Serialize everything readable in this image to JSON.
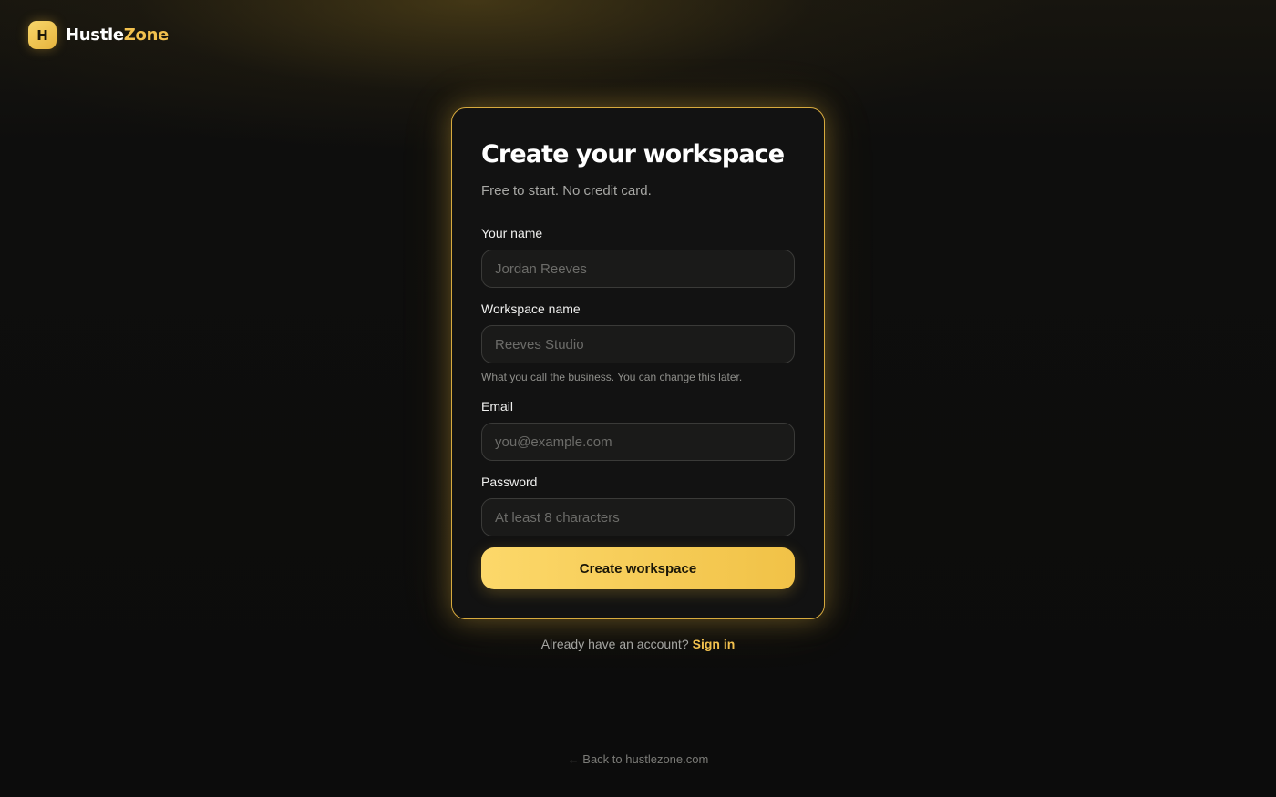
{
  "brand": {
    "mark_letter": "H",
    "name_part1": "Hustle",
    "name_part2": "Zone"
  },
  "form": {
    "title": "Create your workspace",
    "subtitle": "Free to start. No credit card.",
    "fields": [
      {
        "label": "Your name",
        "placeholder": "Jordan Reeves",
        "value": ""
      },
      {
        "label": "Workspace name",
        "placeholder": "Reeves Studio",
        "value": "",
        "help": "What you call the business. You can change this later."
      },
      {
        "label": "Email",
        "placeholder": "you@example.com",
        "value": ""
      },
      {
        "label": "Password",
        "placeholder": "At least 8 characters",
        "value": ""
      }
    ],
    "submit_label": "Create workspace"
  },
  "footer": {
    "signin_prompt": "Already have an account?",
    "signin_link": "Sign in",
    "back_link": "← Back to hustlezone.com"
  },
  "colors": {
    "accent": "#f2c14e",
    "background": "#0d0d0c",
    "card": "#121212",
    "card_border": "#d7aa3e"
  }
}
